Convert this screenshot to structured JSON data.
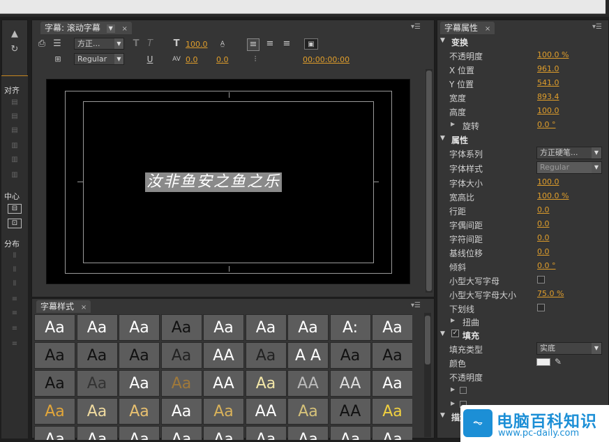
{
  "title_panel": {
    "tab_label": "字幕: 滚动字幕",
    "font_family_value": "方正...",
    "font_style_value": "Regular",
    "font_size_value": "100.0",
    "kerning_value": "0.0",
    "leading_value": "0.0",
    "timecode": "00:00:00:00",
    "sample_text": "汝非鱼安之鱼之乐"
  },
  "styles_panel": {
    "tab_label": "字幕样式",
    "sample_glyph": "Aa",
    "cells": [
      {
        "label": "Aa",
        "bg": "#5c5c5c",
        "fg": "#ffffff"
      },
      {
        "label": "Aa",
        "bg": "#5c5c5c",
        "fg": "#ffffff"
      },
      {
        "label": "Aa",
        "bg": "#5c5c5c",
        "fg": "#ffffff"
      },
      {
        "label": "Aa",
        "bg": "#5c5c5c",
        "fg": "#111111"
      },
      {
        "label": "Aa",
        "bg": "#5c5c5c",
        "fg": "#ffffff"
      },
      {
        "label": "Aa",
        "bg": "#5c5c5c",
        "fg": "#ffffff"
      },
      {
        "label": "Aa",
        "bg": "#5c5c5c",
        "fg": "#ffffff"
      },
      {
        "label": "A:",
        "bg": "#5c5c5c",
        "fg": "#ffffff"
      },
      {
        "label": "Aa",
        "bg": "#5c5c5c",
        "fg": "#ffffff"
      },
      {
        "label": "Aa",
        "bg": "#5c5c5c",
        "fg": "#111111"
      },
      {
        "label": "Aa",
        "bg": "#5c5c5c",
        "fg": "#111111"
      },
      {
        "label": "Aa",
        "bg": "#5c5c5c",
        "fg": "#111111"
      },
      {
        "label": "Aa",
        "bg": "#5c5c5c",
        "fg": "#222222"
      },
      {
        "label": "AA",
        "bg": "#5c5c5c",
        "fg": "#ffffff"
      },
      {
        "label": "Aa",
        "bg": "#5c5c5c",
        "fg": "#222222"
      },
      {
        "label": "A A",
        "bg": "#5c5c5c",
        "fg": "#ffffff"
      },
      {
        "label": "Aa",
        "bg": "#5c5c5c",
        "fg": "#111111"
      },
      {
        "label": "Aa",
        "bg": "#5c5c5c",
        "fg": "#111111"
      },
      {
        "label": "Aa",
        "bg": "#5c5c5c",
        "fg": "#111111"
      },
      {
        "label": "Aa",
        "bg": "#5c5c5c",
        "fg": "#333333"
      },
      {
        "label": "Aa",
        "bg": "#5c5c5c",
        "fg": "#ffffff"
      },
      {
        "label": "Aa",
        "bg": "#5c5c5c",
        "fg": "#a0793a"
      },
      {
        "label": "AA",
        "bg": "#5c5c5c",
        "fg": "#ffffff"
      },
      {
        "label": "Aa",
        "bg": "#5c5c5c",
        "fg": "#f3e7a8"
      },
      {
        "label": "AA",
        "bg": "#5c5c5c",
        "fg": "#bbbbbb"
      },
      {
        "label": "AA",
        "bg": "#5c5c5c",
        "fg": "#dddddd"
      },
      {
        "label": "Aa",
        "bg": "#5c5c5c",
        "fg": "#ffffff"
      },
      {
        "label": "Aa",
        "bg": "#5c5c5c",
        "fg": "#e2a63a"
      },
      {
        "label": "Aa",
        "bg": "#5c5c5c",
        "fg": "#f0dba0"
      },
      {
        "label": "Aa",
        "bg": "#5c5c5c",
        "fg": "#e8c070"
      },
      {
        "label": "Aa",
        "bg": "#5c5c5c",
        "fg": "#ffffff"
      },
      {
        "label": "Aa",
        "bg": "#5c5c5c",
        "fg": "#d9b25a"
      },
      {
        "label": "AA",
        "bg": "#5c5c5c",
        "fg": "#ffffff"
      },
      {
        "label": "Aa",
        "bg": "#5c5c5c",
        "fg": "#d6c27a"
      },
      {
        "label": "AA",
        "bg": "#5c5c5c",
        "fg": "#111111"
      },
      {
        "label": "Aa",
        "bg": "#5c5c5c",
        "fg": "#f0d040"
      },
      {
        "label": "Aa",
        "bg": "#5c5c5c",
        "fg": "#ffffff"
      },
      {
        "label": "Aa",
        "bg": "#5c5c5c",
        "fg": "#ffffff"
      },
      {
        "label": "Aa",
        "bg": "#5c5c5c",
        "fg": "#ffffff"
      },
      {
        "label": "Aa",
        "bg": "#5c5c5c",
        "fg": "#ffffff"
      },
      {
        "label": "Aa",
        "bg": "#5c5c5c",
        "fg": "#ffffff"
      },
      {
        "label": "Aa",
        "bg": "#5c5c5c",
        "fg": "#ffffff"
      },
      {
        "label": "Aa",
        "bg": "#5c5c5c",
        "fg": "#ffffff"
      },
      {
        "label": "Aa",
        "bg": "#5c5c5c",
        "fg": "#ffffff"
      },
      {
        "label": "Aa",
        "bg": "#5c5c5c",
        "fg": "#ffffff"
      }
    ]
  },
  "align_panel": {
    "align_label": "对齐",
    "center_label": "中心",
    "distribute_label": "分布"
  },
  "props_panel": {
    "tab_label": "字幕属性",
    "transform_section": "变换",
    "opacity_label": "不透明度",
    "opacity_value": "100.0 %",
    "x_label": "X 位置",
    "x_value": "961.0",
    "y_label": "Y 位置",
    "y_value": "541.0",
    "width_label": "宽度",
    "width_value": "893.4",
    "height_label": "高度",
    "height_value": "100.0",
    "rotation_label": "旋转",
    "rotation_value": "0.0 °",
    "properties_section": "属性",
    "font_family_label": "字体系列",
    "font_family_value": "方正硬笔...",
    "font_style_label": "字体样式",
    "font_style_value": "Regular",
    "font_size_label": "字体大小",
    "font_size_value": "100.0",
    "aspect_label": "宽高比",
    "aspect_value": "100.0 %",
    "leading_label": "行距",
    "leading_value": "0.0",
    "kerning_label": "字偶间距",
    "kerning_value": "0.0",
    "tracking_label": "字符间距",
    "tracking_value": "0.0",
    "baseline_label": "基线位移",
    "baseline_value": "0.0",
    "slant_label": "倾斜",
    "slant_value": "0.0 °",
    "small_caps_label": "小型大写字母",
    "small_caps_size_label": "小型大写字母大小",
    "small_caps_size_value": "75.0 %",
    "underline_label": "下划线",
    "distort_label": "扭曲",
    "fill_section": "填充",
    "fill_type_label": "填充类型",
    "fill_type_value": "实底",
    "color_label": "颜色",
    "fill_opacity_label": "不透明度",
    "next_section": "描边",
    "accent_color": "#e09e2b"
  },
  "watermark": {
    "title": "电脑百科知识",
    "url": "www.pc-daily.com"
  }
}
